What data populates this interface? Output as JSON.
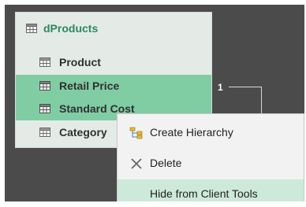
{
  "table": {
    "name": "dProducts",
    "fields": [
      {
        "label": "Product",
        "selected": false
      },
      {
        "label": "Retail Price",
        "selected": true
      },
      {
        "label": "Standard Cost",
        "selected": true
      },
      {
        "label": "Category",
        "selected": false
      }
    ]
  },
  "relationship": {
    "cardinality": "1"
  },
  "context_menu": {
    "items": [
      {
        "label": "Create Hierarchy",
        "icon": "hierarchy-icon"
      },
      {
        "label": "Delete",
        "icon": "delete-icon"
      },
      {
        "label": "Hide from Client Tools",
        "icon": "none"
      }
    ]
  },
  "colors": {
    "canvas": "#4b4b4b",
    "table_background": "#e4ebe7",
    "title": "#2b8a5c",
    "selection": "#80cda4",
    "menu_background": "#f2f2f2",
    "menu_hover": "#cde9d9"
  }
}
